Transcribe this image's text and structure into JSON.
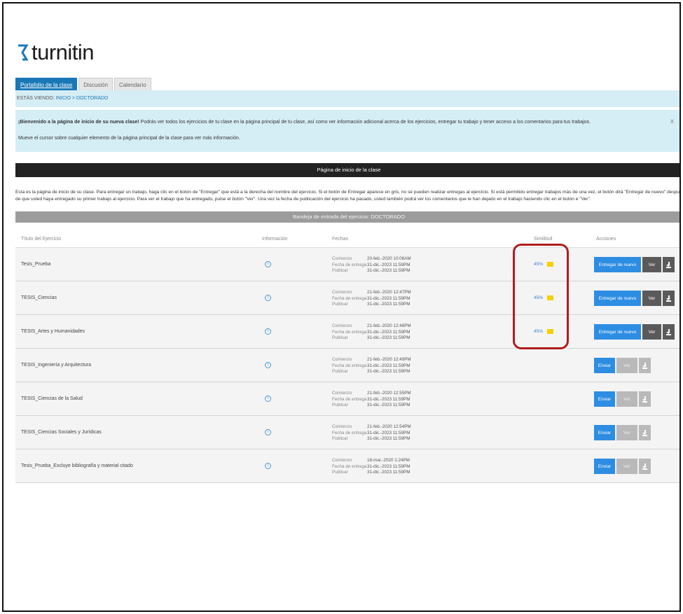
{
  "brand": {
    "name": "turnitin",
    "accent": "#1a78b7"
  },
  "tabs": [
    {
      "label": "Portafolio de la clase",
      "active": true
    },
    {
      "label": "Discusión",
      "active": false
    },
    {
      "label": "Calendario",
      "active": false
    }
  ],
  "breadcrumb": {
    "prefix": "ESTÁS VIENDO:",
    "path": "INICIO > DOCTORADO"
  },
  "welcome": {
    "bold": "¡Bienvenido a la página de inicio de su nueva clase!",
    "text": " Podrás ver todos los ejercicios de tu clase en la página principal de tu clase, así como ver información adicional acerca de los ejercicios, entregar tu trabajo y tener acceso a los comentarios para tus trabajos.",
    "line2": "Mueve el cursor sobre cualquier elemento de la página principal de la clase para ver más información.",
    "close": "x"
  },
  "home_bar": "Página de inicio de la clase",
  "intro": {
    "line1": "Esta es la página de inicio de su clase. Para entregar un trabajo, haga clic en el botón de \"Entregar\" que está a la derecha del nombre del ejercicio. Si el botón de Entregar aparece en gris, no se pueden realizar entregas al ejercicio. Si está permitido entregar trabajos más de una vez, el botón dirá \"Entregar de nuevo\" después",
    "line2": "de que usted haya entregado su primer trabajo al ejercicio. Para ver el trabajo que ha entregado, pulse el botón \"Ver\". Una vez la fecha de publicación del ejercicio ha pasado, usted también podrá ver los comentarios que le han dejado en el trabajo haciendo clic en el botón e \"Ver\"."
  },
  "inbox_bar": "Bandeja de entrada del ejercicio: DOCTORADO",
  "columns": {
    "title": "Título del Ejercicio",
    "info": "Información",
    "dates": "Fechas",
    "similarity": "Similitud",
    "actions": "Acciones"
  },
  "date_labels": {
    "start": "Comienzo",
    "due": "Fecha de entrega",
    "publish": "Publicar"
  },
  "buttons": {
    "resubmit": "Entregar de nuevo",
    "submit": "Enviar",
    "view": "Ver"
  },
  "rows": [
    {
      "title": "Tesis_Prueba",
      "start": "20-feb.-2020 10:08AM",
      "due": "31-dic.-2023 11:59PM",
      "publish": "31-dic.-2023 11:59PM",
      "similarity": "45%",
      "state": "resubmit"
    },
    {
      "title": "TESIS_Ciencias",
      "start": "21-feb.-2020 12:47PM",
      "due": "31-dic.-2023 11:59PM",
      "publish": "31-dic.-2023 11:59PM",
      "similarity": "45%",
      "state": "resubmit"
    },
    {
      "title": "TESIS_Artes y Humanidades",
      "start": "21-feb.-2020 12:48PM",
      "due": "31-dic.-2023 11:59PM",
      "publish": "31-dic.-2023 11:59PM",
      "similarity": "45%",
      "state": "resubmit"
    },
    {
      "title": "TESIS_Ingeniería y Arquitectura",
      "start": "21-feb.-2020 12:49PM",
      "due": "31-dic.-2023 11:59PM",
      "publish": "31-dic.-2023 11:59PM",
      "similarity": "",
      "state": "submit"
    },
    {
      "title": "TESIS_Ciencias de la Salud",
      "start": "21-feb.-2020 12:55PM",
      "due": "31-dic.-2023 11:59PM",
      "publish": "31-dic.-2023 11:59PM",
      "similarity": "",
      "state": "submit"
    },
    {
      "title": "TESIS_Ciencias Sociales y Jurídicas",
      "start": "21-feb.-2020 12:54PM",
      "due": "31-dic.-2023 11:59PM",
      "publish": "31-dic.-2023 11:59PM",
      "similarity": "",
      "state": "submit"
    },
    {
      "title": "Tesis_Prueba_Excluye bibliografía y material citado",
      "start": "18-mar.-2020 1:24PM",
      "due": "31-dic.-2023 11:59PM",
      "publish": "31-dic.-2023 11:59PM",
      "similarity": "",
      "state": "submit"
    }
  ]
}
